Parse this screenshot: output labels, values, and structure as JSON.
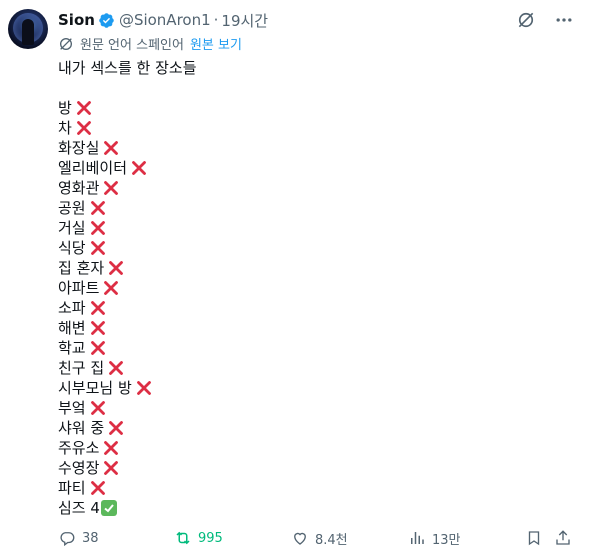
{
  "author": {
    "name": "Sion",
    "handle": "@SionAron1",
    "separator": "·",
    "time": "19시간"
  },
  "translation": {
    "label": "원문 언어 스페인어",
    "show_original": "원본 보기"
  },
  "post": {
    "title": "내가 섹스를 한 장소들",
    "items": [
      {
        "text": "방",
        "mark": "cross"
      },
      {
        "text": "차",
        "mark": "cross"
      },
      {
        "text": "화장실",
        "mark": "cross"
      },
      {
        "text": "엘리베이터",
        "mark": "cross"
      },
      {
        "text": "영화관",
        "mark": "cross"
      },
      {
        "text": "공원",
        "mark": "cross"
      },
      {
        "text": "거실",
        "mark": "cross"
      },
      {
        "text": "식당",
        "mark": "cross"
      },
      {
        "text": "집 혼자",
        "mark": "cross"
      },
      {
        "text": "아파트",
        "mark": "cross"
      },
      {
        "text": "소파",
        "mark": "cross"
      },
      {
        "text": "해변",
        "mark": "cross"
      },
      {
        "text": "학교",
        "mark": "cross"
      },
      {
        "text": "친구 집",
        "mark": "cross"
      },
      {
        "text": "시부모님 방",
        "mark": "cross"
      },
      {
        "text": "부엌",
        "mark": "cross"
      },
      {
        "text": "샤워 중",
        "mark": "cross"
      },
      {
        "text": "주유소",
        "mark": "cross"
      },
      {
        "text": "수영장",
        "mark": "cross"
      },
      {
        "text": "파티",
        "mark": "cross"
      },
      {
        "text": "심즈 4",
        "mark": "check"
      }
    ]
  },
  "actions": {
    "replies": "38",
    "reposts": "995",
    "likes": "8.4천",
    "views": "13만"
  },
  "colors": {
    "text": "#0f1419",
    "muted": "#536471",
    "link": "#1d9bf0",
    "repost": "#00ba7c",
    "cross": "#dd2e44",
    "check": "#5cb85c",
    "verified": "#1d9bf0"
  }
}
